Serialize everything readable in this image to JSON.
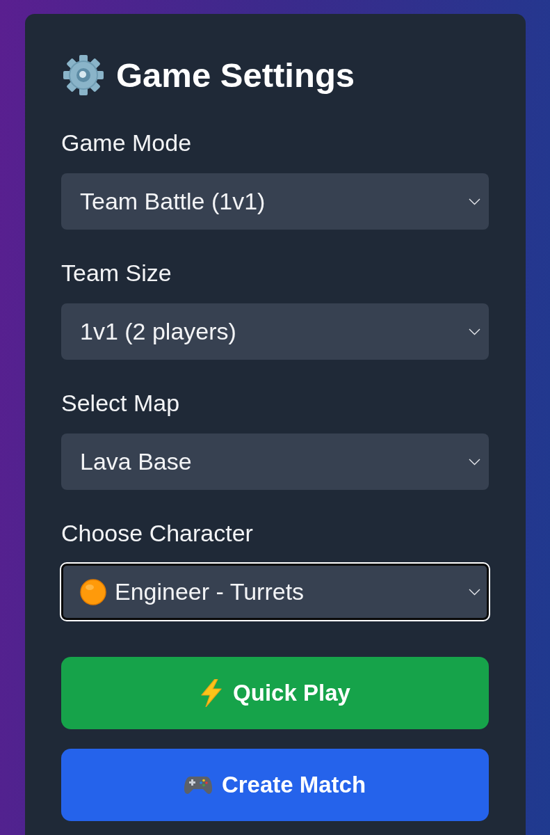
{
  "panel": {
    "title": "Game Settings"
  },
  "fields": [
    {
      "label": "Game Mode",
      "value": "Team Battle (1v1)",
      "kind": "plain",
      "focused": false
    },
    {
      "label": "Team Size",
      "value": "1v1 (2 players)",
      "kind": "plain",
      "focused": false
    },
    {
      "label": "Select Map",
      "value": "Lava Base",
      "kind": "plain",
      "focused": false
    },
    {
      "label": "Choose Character",
      "value": "Engineer - Turrets",
      "kind": "character",
      "focused": true
    }
  ],
  "buttons": [
    {
      "label": "Quick Play",
      "kind": "quick",
      "color": "#16a34a"
    },
    {
      "label": "Create Match",
      "kind": "create",
      "color": "#2563eb"
    }
  ]
}
